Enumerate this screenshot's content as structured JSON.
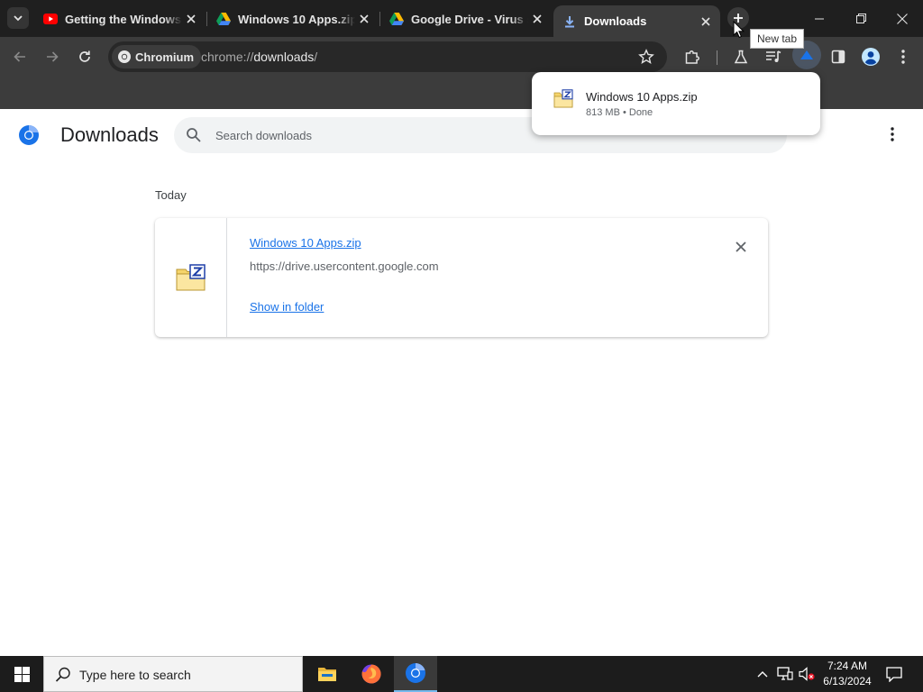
{
  "tabs": [
    {
      "title": "Getting the Windows",
      "favicon": "youtube-icon",
      "active": false
    },
    {
      "title": "Windows 10 Apps.zip",
      "favicon": "google-drive-icon",
      "active": false
    },
    {
      "title": "Google Drive - Virus s",
      "favicon": "google-drive-icon",
      "active": false
    },
    {
      "title": "Downloads",
      "favicon": "download-icon",
      "active": true
    }
  ],
  "tooltip": "New tab",
  "omnibox": {
    "chip_label": "Chromium",
    "url_scheme": "chrome://",
    "url_host": "downloads",
    "url_path": "/"
  },
  "download_bubble": {
    "filename": "Windows 10 Apps.zip",
    "status": "813 MB • Done"
  },
  "page": {
    "title": "Downloads",
    "search_placeholder": "Search downloads",
    "date_header": "Today",
    "items": [
      {
        "filename": "Windows 10 Apps.zip",
        "source_url": "https://drive.usercontent.google.com",
        "action": "Show in folder"
      }
    ]
  },
  "taskbar": {
    "search_placeholder": "Type here to search",
    "time": "7:24 AM",
    "date": "6/13/2024"
  },
  "colors": {
    "link": "#1a73e8",
    "chrome_dark": "#3c3c3c",
    "tabstrip": "#1f1f1f"
  }
}
